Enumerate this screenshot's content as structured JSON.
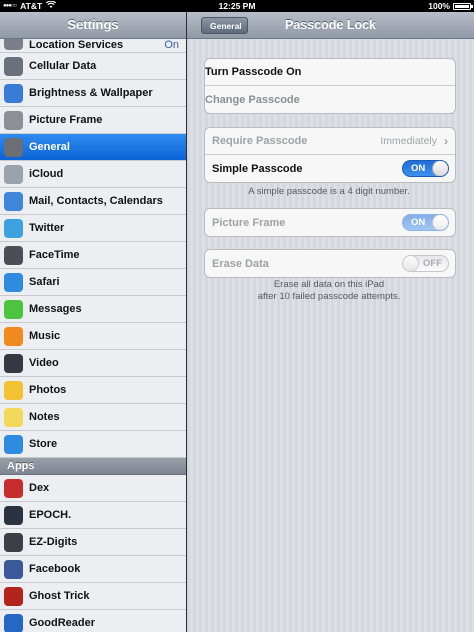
{
  "status_bar": {
    "carrier": "AT&T",
    "time": "12:25 PM",
    "battery": "100%"
  },
  "left_pane": {
    "title": "Settings",
    "items": [
      {
        "label": "Location Services",
        "value": "On",
        "icon": "location-services-icon",
        "color": "#7a7f89"
      },
      {
        "label": "Cellular Data",
        "icon": "cellular-data-icon",
        "color": "#6b717c"
      },
      {
        "label": "Brightness & Wallpaper",
        "icon": "brightness-icon",
        "color": "#3a7bd5"
      },
      {
        "label": "Picture Frame",
        "icon": "picture-frame-icon",
        "color": "#8c8f96"
      },
      {
        "label": "General",
        "icon": "gear-icon",
        "color": "#6b6e74"
      },
      {
        "label": "iCloud",
        "icon": "icloud-icon",
        "color": "#9aa3ad"
      },
      {
        "label": "Mail, Contacts, Calendars",
        "icon": "mail-icon",
        "color": "#3f86d8"
      },
      {
        "label": "Twitter",
        "icon": "twitter-icon",
        "color": "#3da1e0"
      },
      {
        "label": "FaceTime",
        "icon": "facetime-icon",
        "color": "#4a4f57"
      },
      {
        "label": "Safari",
        "icon": "safari-icon",
        "color": "#2f8be0"
      },
      {
        "label": "Messages",
        "icon": "messages-icon",
        "color": "#4cc43f"
      },
      {
        "label": "Music",
        "icon": "music-icon",
        "color": "#f08a1f"
      },
      {
        "label": "Video",
        "icon": "video-icon",
        "color": "#333842"
      },
      {
        "label": "Photos",
        "icon": "photos-icon",
        "color": "#f2c232"
      },
      {
        "label": "Notes",
        "icon": "notes-icon",
        "color": "#f3d95a"
      },
      {
        "label": "Store",
        "icon": "store-icon",
        "color": "#2f8be0"
      }
    ],
    "apps_header": "Apps",
    "apps": [
      {
        "label": "Dex",
        "icon": "dex-icon",
        "color": "#c62e2e"
      },
      {
        "label": "EPOCH.",
        "icon": "epoch-icon",
        "color": "#2b3240"
      },
      {
        "label": "EZ-Digits",
        "icon": "ez-digits-icon",
        "color": "#3c3f45"
      },
      {
        "label": "Facebook",
        "icon": "facebook-icon",
        "color": "#3b5998"
      },
      {
        "label": "Ghost Trick",
        "icon": "ghost-trick-icon",
        "color": "#b3241d"
      },
      {
        "label": "GoodReader",
        "icon": "goodreader-icon",
        "color": "#2667c4"
      }
    ],
    "selected": "General"
  },
  "right_pane": {
    "back_label": "General",
    "title": "Passcode Lock",
    "turn_on_label": "Turn Passcode On",
    "change_label": "Change Passcode",
    "require_label": "Require Passcode",
    "require_value": "Immediately",
    "simple_label": "Simple Passcode",
    "simple_toggle": "ON",
    "simple_note": "A simple passcode is a 4 digit number.",
    "picture_frame_label": "Picture Frame",
    "picture_frame_toggle": "ON",
    "erase_label": "Erase Data",
    "erase_toggle": "OFF",
    "erase_note_line1": "Erase all data on this iPad",
    "erase_note_line2": "after 10 failed passcode attempts."
  }
}
